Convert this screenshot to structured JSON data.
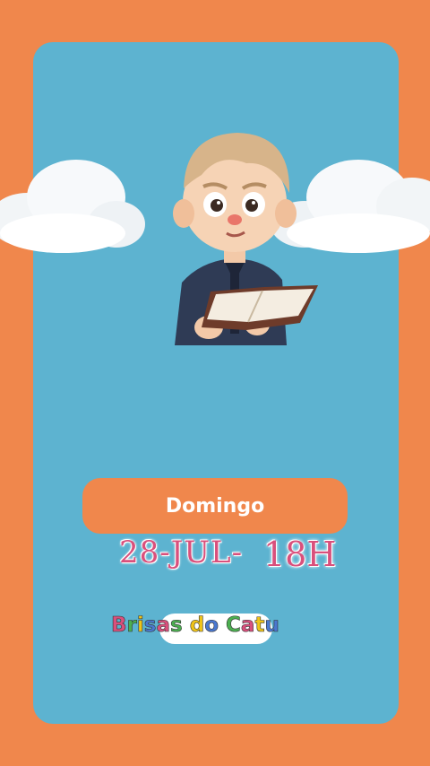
{
  "event": {
    "day_label": "Domingo",
    "date_text": "28-JUL-",
    "time_text": "18H",
    "brand": [
      "B",
      "r",
      "i",
      "s",
      "a",
      "s",
      " ",
      "d",
      "o",
      " ",
      "C",
      "a",
      "t",
      "u"
    ]
  },
  "colors": {
    "background": "#f0874c",
    "card": "#5db3d0",
    "pill": "#f0874c",
    "date": "#d9507c"
  }
}
